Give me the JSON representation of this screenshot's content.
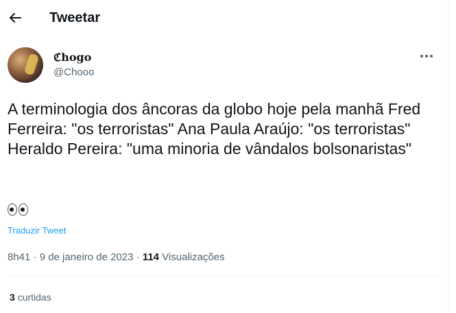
{
  "header": {
    "title": "Tweetar",
    "back_icon": "arrow-left-icon"
  },
  "tweet": {
    "author": {
      "display_name": "ℭhogo",
      "handle": "@Chooo"
    },
    "text": "A terminologia dos âncoras da globo hoje pela manhã Fred Ferreira: \"os terroristas\" Ana Paula Araújo: \"os terroristas\" Heraldo Pereira: \"uma minoria de vândalos bolsonaristas\"",
    "emoji": "eyes-emoji",
    "translate_label": "Traduzir Tweet",
    "timestamp": "8h41 · 9 de janeiro de 2023",
    "separator": "·",
    "views_count": "114",
    "views_label": "Visualizações",
    "retweets_count": "3",
    "retweets_label": "curtidas"
  },
  "colors": {
    "accent": "#1d9bf0",
    "secondary_text": "#536471",
    "primary_text": "#0f1419"
  }
}
